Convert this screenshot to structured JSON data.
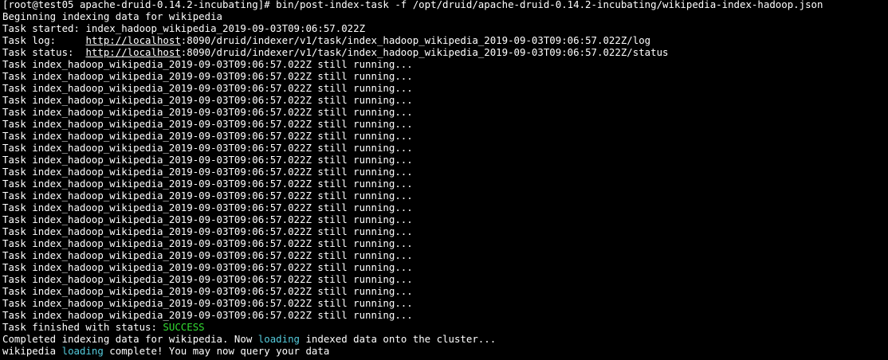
{
  "terminal": {
    "prompt_line": "[root@test05 apache-druid-0.14.2-incubating]# bin/post-index-task -f /opt/druid/apache-druid-0.14.2-incubating/wikipedia-index-hadoop.json",
    "beginning": "Beginning indexing data for wikipedia",
    "task_started_label": "Task started: ",
    "task_started_value": "index_hadoop_wikipedia_2019-09-03T09:06:57.022Z",
    "task_log_label": "Task log:     ",
    "task_log_url": "http://localhost",
    "task_log_rest": ":8090/druid/indexer/v1/task/index_hadoop_wikipedia_2019-09-03T09:06:57.022Z/log",
    "task_status_label": "Task status:  ",
    "task_status_url": "http://localhost",
    "task_status_rest": ":8090/druid/indexer/v1/task/index_hadoop_wikipedia_2019-09-03T09:06:57.022Z/status",
    "running_lines": [
      "Task index_hadoop_wikipedia_2019-09-03T09:06:57.022Z still running...",
      "Task index_hadoop_wikipedia_2019-09-03T09:06:57.022Z still running...",
      "Task index_hadoop_wikipedia_2019-09-03T09:06:57.022Z still running...",
      "Task index_hadoop_wikipedia_2019-09-03T09:06:57.022Z still running...",
      "Task index_hadoop_wikipedia_2019-09-03T09:06:57.022Z still running...",
      "Task index_hadoop_wikipedia_2019-09-03T09:06:57.022Z still running...",
      "Task index_hadoop_wikipedia_2019-09-03T09:06:57.022Z still running...",
      "Task index_hadoop_wikipedia_2019-09-03T09:06:57.022Z still running...",
      "Task index_hadoop_wikipedia_2019-09-03T09:06:57.022Z still running...",
      "Task index_hadoop_wikipedia_2019-09-03T09:06:57.022Z still running...",
      "Task index_hadoop_wikipedia_2019-09-03T09:06:57.022Z still running...",
      "Task index_hadoop_wikipedia_2019-09-03T09:06:57.022Z still running...",
      "Task index_hadoop_wikipedia_2019-09-03T09:06:57.022Z still running...",
      "Task index_hadoop_wikipedia_2019-09-03T09:06:57.022Z still running...",
      "Task index_hadoop_wikipedia_2019-09-03T09:06:57.022Z still running...",
      "Task index_hadoop_wikipedia_2019-09-03T09:06:57.022Z still running...",
      "Task index_hadoop_wikipedia_2019-09-03T09:06:57.022Z still running...",
      "Task index_hadoop_wikipedia_2019-09-03T09:06:57.022Z still running...",
      "Task index_hadoop_wikipedia_2019-09-03T09:06:57.022Z still running...",
      "Task index_hadoop_wikipedia_2019-09-03T09:06:57.022Z still running...",
      "Task index_hadoop_wikipedia_2019-09-03T09:06:57.022Z still running...",
      "Task index_hadoop_wikipedia_2019-09-03T09:06:57.022Z still running..."
    ],
    "finished_label": "Task finished with status: ",
    "finished_status": "SUCCESS",
    "completed_prefix": "Completed indexing data for wikipedia. Now ",
    "completed_loading": "loading",
    "completed_suffix": " indexed data onto the cluster...",
    "final_prefix": "wikipedia ",
    "final_loading": "loading",
    "final_suffix": " complete! You may now query your data",
    "colors": {
      "background": "#000000",
      "text": "#ffffff",
      "success": "#33dd33",
      "highlight": "#55ccdd"
    }
  }
}
